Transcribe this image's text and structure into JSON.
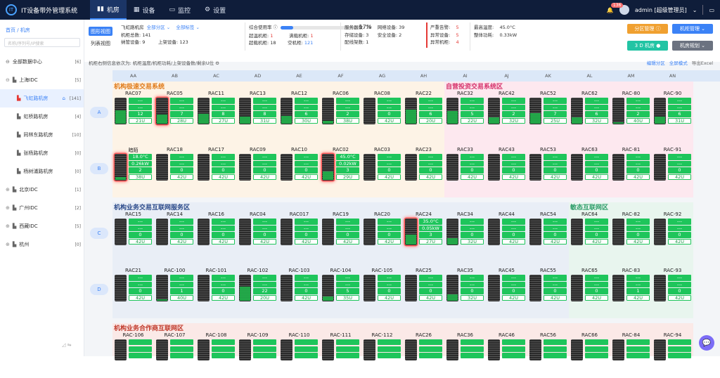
{
  "app": {
    "title": "IT设备带外管理系统",
    "logo": "IT"
  },
  "nav": [
    {
      "label": "机房",
      "icon": "▮▮",
      "icon_name": "rack-icon"
    },
    {
      "label": "设备",
      "icon": "▦",
      "icon_name": "grid-icon"
    },
    {
      "label": "监控",
      "icon": "▭",
      "icon_name": "monitor-icon"
    },
    {
      "label": "设置",
      "icon": "⚙",
      "icon_name": "gear-icon"
    }
  ],
  "user": {
    "badge": "136",
    "name": "admin [超级管理员]",
    "dropdown": "⌄",
    "screen_icon": "▭"
  },
  "sidebar": {
    "breadcrumb": "首页 / 机房",
    "search_placeholder": "名称/序列号/IP搜索",
    "tree": [
      {
        "label": "全部数据中心",
        "count": "[6]",
        "icon": "⊖",
        "level": 0
      },
      {
        "label": "上海IDC",
        "count": "[5]",
        "icon": "▙",
        "level": 0,
        "expand": "⊖"
      },
      {
        "label": "飞虹路机房",
        "count": "[141]",
        "icon": "▙",
        "level": 1,
        "selected": true,
        "home": "⌂"
      },
      {
        "label": "虹桥路机房",
        "count": "[4]",
        "icon": "▙",
        "level": 1
      },
      {
        "label": "同林东路机房",
        "count": "[10]",
        "icon": "▙",
        "level": 1
      },
      {
        "label": "张杨路机房",
        "count": "[0]",
        "icon": "▙",
        "level": 1
      },
      {
        "label": "杨树浦路机房",
        "count": "[0]",
        "icon": "▙",
        "level": 1
      },
      {
        "label": "北京IDC",
        "count": "[1]",
        "icon": "▙",
        "level": 0,
        "expand": "⊕"
      },
      {
        "label": "广州IDC",
        "count": "[2]",
        "icon": "▙",
        "level": 0,
        "expand": "⊕"
      },
      {
        "label": "西藏IDC",
        "count": "[5]",
        "icon": "▙",
        "level": 0,
        "expand": "⊕"
      },
      {
        "label": "杭州",
        "count": "[0]",
        "icon": "▙",
        "level": 0,
        "expand": "⊕"
      }
    ],
    "footer_icons": "◿ ⇋"
  },
  "header": {
    "view_map": "图形视图",
    "view_list": "列表视图",
    "room": "飞虹路机房",
    "zone_filter": "全部分区 ⌄",
    "tag_filter": "全部标签 ⌄",
    "rack_total_label": "机柜总数:",
    "rack_total": "141",
    "devices_label": "纳管设备:",
    "devices": "9",
    "used_u_label": "上架设备:",
    "used_u": "123",
    "usage_label": "综合使用率",
    "usage_pct": "17%",
    "usage_value": 17,
    "over_label": "超温机柜:",
    "over": "1",
    "overload_label": "超载机柜:",
    "overload": "18",
    "full_label": "满载机柜:",
    "full": "1",
    "empty_label": "空机柜:",
    "empty": "121",
    "server_label": "服务器数:",
    "server": "79",
    "network_label": "网络设备:",
    "network": "39",
    "storage_label": "存储设备:",
    "storage": "3",
    "security_label": "安全设备:",
    "security": "2",
    "other_label": "配线架数:",
    "other": "1",
    "alarm1_label": "严重告警:",
    "alarm1": "5",
    "alarm2_label": "异常设备:",
    "alarm2": "5",
    "alarm3_label": "异常机柜:",
    "alarm3": "4",
    "temp_label": "最高温度:",
    "temp": "45.0°C",
    "power_label": "整体功耗:",
    "power": "0.33kW",
    "btn_zone": "分区管理 ⓘ",
    "btn_rack": "机柜管理 ⌄",
    "btn_3d": "3 D 机房 ●",
    "btn_plan": "机房规划 ⌄",
    "note": "机柜右侧信息依次为: 机柜温度/机柜功耗/上架设备数/剩余U位 ⚙",
    "links": [
      "编辑分区",
      "全屏模式",
      "导出Excel"
    ]
  },
  "columns": [
    "AA",
    "AB",
    "AC",
    "AD",
    "AE",
    "AF",
    "AG",
    "AH",
    "AI",
    "AJ",
    "AK",
    "AL",
    "AM",
    "AN"
  ],
  "rows": [
    "A",
    "B",
    "C",
    "D",
    ""
  ],
  "zones": [
    {
      "name": "机构极速交易系统",
      "row": 0,
      "col": 0,
      "color": "#e07b1a"
    },
    {
      "name": "自营投资交易系统区",
      "row": 0,
      "col": 8,
      "color": "#d6336c"
    },
    {
      "name": "机构业务交易互联网服务区",
      "row": 2,
      "col": 0,
      "color": "#2b4a8a"
    },
    {
      "name": "敏态互联网区",
      "row": 2,
      "col": 11,
      "color": "#2f9e6a"
    },
    {
      "name": "机构业务合作商互联网区",
      "row": 4,
      "col": 0,
      "color": "#c0392b"
    }
  ],
  "racks": [
    [
      {
        "n": "RAC07",
        "t": "---",
        "p": "---",
        "d": "12",
        "u": "21U",
        "f": 0.5
      },
      {
        "n": "RAC05",
        "t": "---",
        "p": "---",
        "d": "7",
        "u": "28U",
        "f": 0.33,
        "hot": true
      },
      {
        "n": "RAC11",
        "t": "---",
        "p": "---",
        "d": "8",
        "u": "27U",
        "f": 0.36
      },
      {
        "n": "RAC13",
        "t": "---",
        "p": "---",
        "d": "8",
        "u": "31U",
        "f": 0.26
      },
      {
        "n": "RAC12",
        "t": "---",
        "p": "---",
        "d": "6",
        "u": "30U",
        "f": 0.29
      },
      {
        "n": "RAC06",
        "t": "---",
        "p": "---",
        "d": "2",
        "u": "38U",
        "f": 0.1
      },
      {
        "n": "RAC08",
        "t": "---",
        "p": "---",
        "d": "0",
        "u": "42U",
        "f": 0
      },
      {
        "n": "RAC22",
        "t": "---",
        "p": "---",
        "d": "6",
        "u": "20U",
        "f": 0.52
      },
      {
        "n": "RAC32",
        "t": "---",
        "p": "---",
        "d": "5",
        "u": "22U",
        "f": 0.48
      },
      {
        "n": "RAC42",
        "t": "---",
        "p": "---",
        "d": "2",
        "u": "32U",
        "f": 0.24
      },
      {
        "n": "RAC52",
        "t": "---",
        "p": "---",
        "d": "7",
        "u": "25U",
        "f": 0.4
      },
      {
        "n": "RAC62",
        "t": "---",
        "p": "---",
        "d": "6",
        "u": "32U",
        "f": 0.24
      },
      {
        "n": "RAC-80",
        "t": "---",
        "p": "---",
        "d": "2",
        "u": "40U",
        "f": 0.05
      },
      {
        "n": "RAC-90",
        "t": "---",
        "p": "---",
        "d": "6",
        "u": "31U",
        "f": 0.26
      }
    ],
    [
      {
        "n": "暗陌",
        "t": "18.0°C",
        "p": "0.26kW",
        "d": "2",
        "u": "38U",
        "f": 0.1,
        "hot": true
      },
      {
        "n": "RAC18",
        "t": "---",
        "p": "---",
        "d": "0",
        "u": "42U",
        "f": 0
      },
      {
        "n": "RAC17",
        "t": "---",
        "p": "---",
        "d": "0",
        "u": "42U",
        "f": 0
      },
      {
        "n": "RAC09",
        "t": "---",
        "p": "---",
        "d": "0",
        "u": "42U",
        "f": 0
      },
      {
        "n": "RAC10",
        "t": "---",
        "p": "---",
        "d": "0",
        "u": "42U",
        "f": 0
      },
      {
        "n": "RAC02",
        "t": "45.0°C",
        "p": "0.02kW",
        "d": "3",
        "u": "29U",
        "f": 0.31,
        "hot": true
      },
      {
        "n": "RAC03",
        "t": "---",
        "p": "---",
        "d": "0",
        "u": "42U",
        "f": 0
      },
      {
        "n": "RAC23",
        "t": "---",
        "p": "---",
        "d": "0",
        "u": "42U",
        "f": 0
      },
      {
        "n": "RAC33",
        "t": "---",
        "p": "---",
        "d": "0",
        "u": "42U",
        "f": 0
      },
      {
        "n": "RAC43",
        "t": "---",
        "p": "---",
        "d": "0",
        "u": "42U",
        "f": 0
      },
      {
        "n": "RAC53",
        "t": "---",
        "p": "---",
        "d": "0",
        "u": "42U",
        "f": 0
      },
      {
        "n": "RAC63",
        "t": "---",
        "p": "---",
        "d": "0",
        "u": "42U",
        "f": 0
      },
      {
        "n": "RAC-81",
        "t": "---",
        "p": "---",
        "d": "0",
        "u": "42U",
        "f": 0
      },
      {
        "n": "RAC-91",
        "t": "---",
        "p": "---",
        "d": "0",
        "u": "42U",
        "f": 0
      }
    ],
    [
      {
        "n": "RAC15",
        "t": "---",
        "p": "---",
        "d": "0",
        "u": "42U",
        "f": 0
      },
      {
        "n": "RAC14",
        "t": "---",
        "p": "---",
        "d": "0",
        "u": "42U",
        "f": 0
      },
      {
        "n": "RAC16",
        "t": "---",
        "p": "---",
        "d": "0",
        "u": "42U",
        "f": 0
      },
      {
        "n": "RAC04",
        "t": "---",
        "p": "---",
        "d": "0",
        "u": "42U",
        "f": 0
      },
      {
        "n": "RAC017",
        "t": "---",
        "p": "---",
        "d": "0",
        "u": "42U",
        "f": 0
      },
      {
        "n": "RAC19",
        "t": "---",
        "p": "---",
        "d": "0",
        "u": "42U",
        "f": 0
      },
      {
        "n": "RAC20",
        "t": "---",
        "p": "---",
        "d": "0",
        "u": "42U",
        "f": 0
      },
      {
        "n": "RAC24",
        "t": "35.0°C",
        "p": "0.05kW",
        "d": "3",
        "u": "27U",
        "f": 0.36,
        "hot": true
      },
      {
        "n": "RAC34",
        "t": "---",
        "p": "---",
        "d": "0",
        "u": "32U",
        "f": 0.24
      },
      {
        "n": "RAC44",
        "t": "---",
        "p": "---",
        "d": "0",
        "u": "42U",
        "f": 0
      },
      {
        "n": "RAC54",
        "t": "---",
        "p": "---",
        "d": "0",
        "u": "42U",
        "f": 0
      },
      {
        "n": "RAC64",
        "t": "---",
        "p": "---",
        "d": "0",
        "u": "42U",
        "f": 0
      },
      {
        "n": "RAC-82",
        "t": "---",
        "p": "---",
        "d": "0",
        "u": "42U",
        "f": 0
      },
      {
        "n": "RAC-92",
        "t": "---",
        "p": "---",
        "d": "0",
        "u": "42U",
        "f": 0
      }
    ],
    [
      {
        "n": "RAC21",
        "t": "---",
        "p": "---",
        "d": "0",
        "u": "42U",
        "f": 0
      },
      {
        "n": "RAC-100",
        "t": "---",
        "p": "---",
        "d": "1",
        "u": "40U",
        "f": 0.05
      },
      {
        "n": "RAC-101",
        "t": "---",
        "p": "---",
        "d": "0",
        "u": "42U",
        "f": 0
      },
      {
        "n": "RAC-102",
        "t": "---",
        "p": "---",
        "d": "22",
        "u": "20U",
        "f": 0.52
      },
      {
        "n": "RAC-103",
        "t": "---",
        "p": "---",
        "d": "0",
        "u": "42U",
        "f": 0
      },
      {
        "n": "RAC-104",
        "t": "---",
        "p": "---",
        "d": "5",
        "u": "35U",
        "f": 0.17
      },
      {
        "n": "RAC-105",
        "t": "---",
        "p": "---",
        "d": "0",
        "u": "42U",
        "f": 0
      },
      {
        "n": "RAC25",
        "t": "---",
        "p": "---",
        "d": "0",
        "u": "42U",
        "f": 0
      },
      {
        "n": "RAC35",
        "t": "---",
        "p": "---",
        "d": "0",
        "u": "32U",
        "f": 0.24
      },
      {
        "n": "RAC45",
        "t": "---",
        "p": "---",
        "d": "0",
        "u": "42U",
        "f": 0
      },
      {
        "n": "RAC55",
        "t": "---",
        "p": "---",
        "d": "0",
        "u": "42U",
        "f": 0
      },
      {
        "n": "RAC65",
        "t": "---",
        "p": "---",
        "d": "0",
        "u": "42U",
        "f": 0
      },
      {
        "n": "RAC-83",
        "t": "---",
        "p": "---",
        "d": "1",
        "u": "42U",
        "f": 0
      },
      {
        "n": "RAC-93",
        "t": "---",
        "p": "---",
        "d": "0",
        "u": "42U",
        "f": 0
      }
    ],
    [
      {
        "n": "RAC-106"
      },
      {
        "n": "RAC-107"
      },
      {
        "n": "RAC-108"
      },
      {
        "n": "RAC-109"
      },
      {
        "n": "RAC-110"
      },
      {
        "n": "RAC-111"
      },
      {
        "n": "RAC-112"
      },
      {
        "n": "RAC26"
      },
      {
        "n": "RAC36"
      },
      {
        "n": "RAC46"
      },
      {
        "n": "RAC56"
      },
      {
        "n": "RAC66"
      },
      {
        "n": "RAC-84"
      },
      {
        "n": "RAC-94"
      }
    ]
  ],
  "colors": {
    "accent": "#3b82f6",
    "green": "#1ec55b",
    "orange": "#f0a030",
    "topbar": "#0f1d3a"
  }
}
